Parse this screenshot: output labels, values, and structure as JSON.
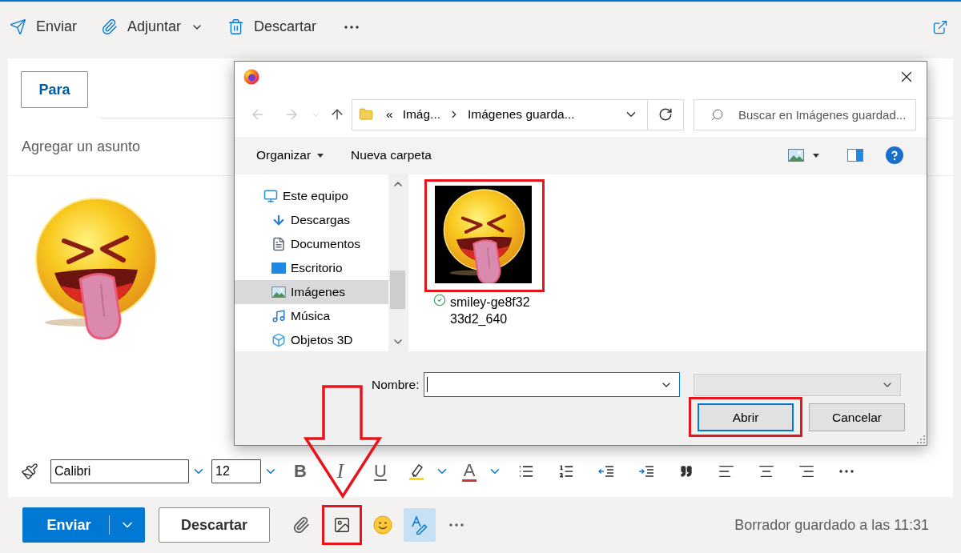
{
  "top_toolbar": {
    "items": [
      {
        "kind": "send",
        "label": "Enviar"
      },
      {
        "kind": "attach",
        "label": "Adjuntar"
      },
      {
        "kind": "discard",
        "label": "Descartar"
      },
      {
        "kind": "more"
      }
    ]
  },
  "compose": {
    "to_button": "Para",
    "subject": {
      "placeholder": "Agregar un asunto"
    }
  },
  "format_toolbar": {
    "font": {
      "value": "Calibri"
    },
    "size": {
      "value": "12"
    },
    "tools": [
      {
        "kind": "bold",
        "label": "B"
      },
      {
        "kind": "italic",
        "label": "I"
      },
      {
        "kind": "underline",
        "label": "U"
      },
      {
        "kind": "highlight"
      },
      {
        "kind": "font_color",
        "label": "A"
      },
      {
        "kind": "bullets"
      },
      {
        "kind": "numbering"
      },
      {
        "kind": "outdent"
      },
      {
        "kind": "indent"
      },
      {
        "kind": "quote"
      },
      {
        "kind": "align_left"
      },
      {
        "kind": "align_center"
      },
      {
        "kind": "align_right"
      },
      {
        "kind": "more"
      }
    ]
  },
  "bottom_bar": {
    "send_button": "Enviar",
    "discard_button": "Descartar",
    "actions": [
      {
        "kind": "attach",
        "on": false,
        "highlighted": false
      },
      {
        "kind": "image",
        "on": false,
        "highlighted": true
      },
      {
        "kind": "emoji",
        "on": false,
        "highlighted": false
      },
      {
        "kind": "editor",
        "on": true,
        "highlighted": false
      },
      {
        "kind": "more",
        "on": false,
        "highlighted": false
      }
    ],
    "status": "Borrador guardado a las 11:31"
  },
  "file_dialog": {
    "nav_buttons": [
      {
        "kind": "back",
        "disabled": true
      },
      {
        "kind": "forward",
        "disabled": true
      },
      {
        "kind": "recent",
        "disabled": true
      },
      {
        "kind": "up",
        "disabled": false
      }
    ],
    "address": {
      "overflow": "«",
      "path": [
        "Imág...",
        "Imágenes guarda..."
      ]
    },
    "search": {
      "placeholder": "Buscar en Imágenes guardad..."
    },
    "commands": [
      {
        "kind": "menu",
        "label": "Organizar"
      },
      {
        "kind": "button",
        "label": "Nueva carpeta"
      }
    ],
    "nav_tree": [
      {
        "kind": "computer",
        "label": "Este equipo",
        "selected": false,
        "children": [
          {
            "kind": "downloads",
            "label": "Descargas",
            "selected": false
          },
          {
            "kind": "documents",
            "label": "Documentos",
            "selected": false
          },
          {
            "kind": "desktop",
            "label": "Escritorio",
            "selected": false
          },
          {
            "kind": "pictures",
            "label": "Imágenes",
            "selected": true
          },
          {
            "kind": "music",
            "label": "Música",
            "selected": false
          },
          {
            "kind": "objects",
            "label": "Objetos 3D",
            "selected": false
          }
        ]
      }
    ],
    "files": [
      {
        "name": "smiley-ge8f3233d2_640",
        "highlighted": true
      }
    ],
    "file_name": {
      "label": "Nombre:"
    },
    "buttons": [
      {
        "label": "Abrir",
        "default": true,
        "highlighted": true
      },
      {
        "label": "Cancelar",
        "default": false,
        "highlighted": false
      }
    ]
  }
}
